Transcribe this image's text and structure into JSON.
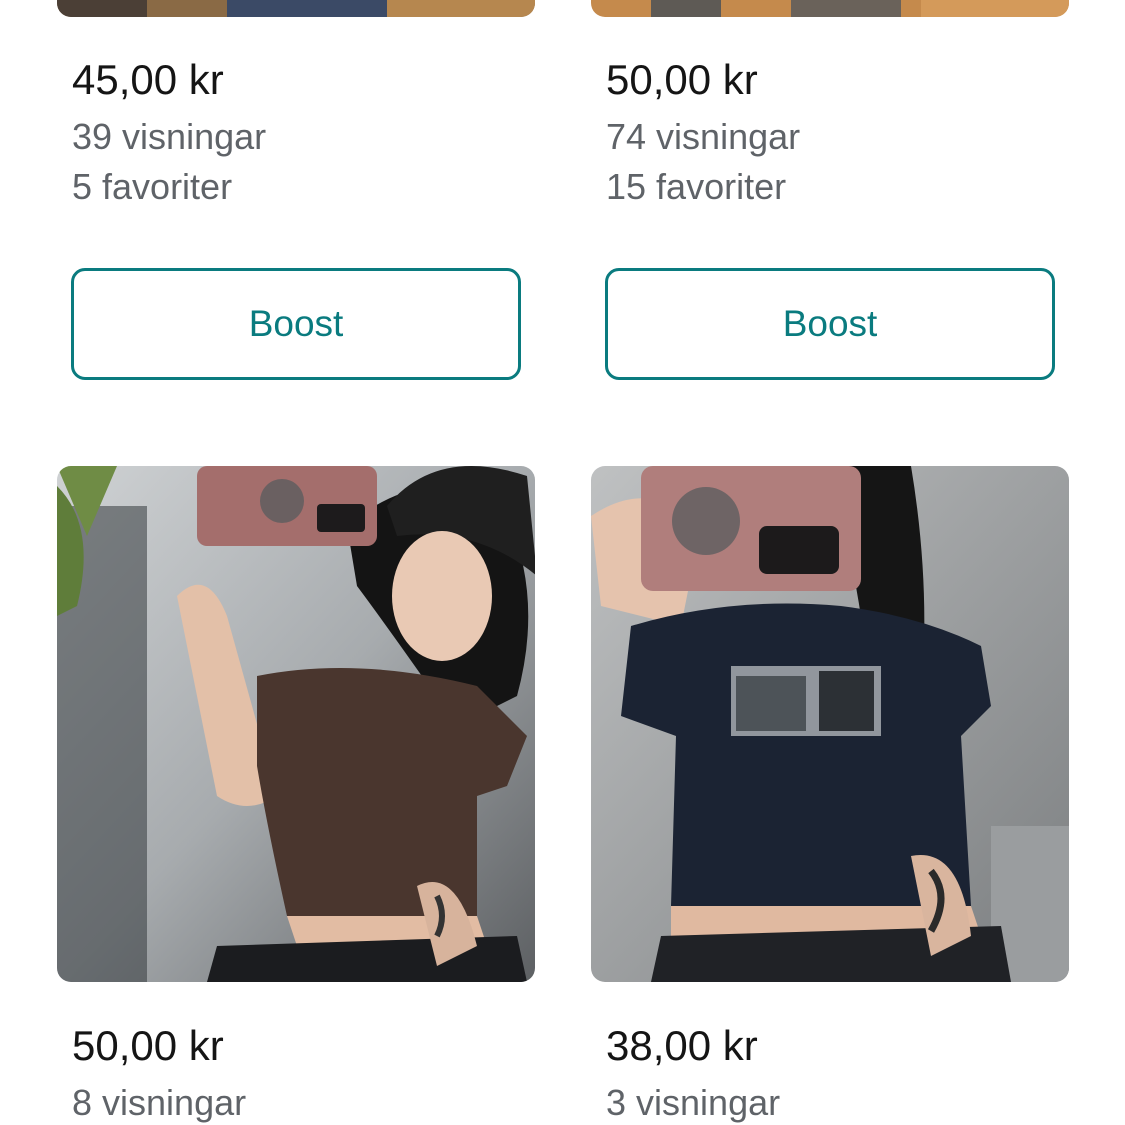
{
  "listings": [
    {
      "price": "45,00 kr",
      "views": "39 visningar",
      "favorites": "5 favoriter",
      "boost_label": "Boost"
    },
    {
      "price": "50,00 kr",
      "views": "74 visningar",
      "favorites": "15 favoriter",
      "boost_label": "Boost"
    },
    {
      "price": "50,00 kr",
      "views": "8 visningar",
      "image": "brown-crop-top-photo"
    },
    {
      "price": "38,00 kr",
      "views": "3 visningar",
      "image": "black-graphic-crop-top-photo"
    }
  ],
  "colors": {
    "accent": "#0a7b7f",
    "secondary_text": "#5f6368",
    "primary_text": "#151515"
  }
}
